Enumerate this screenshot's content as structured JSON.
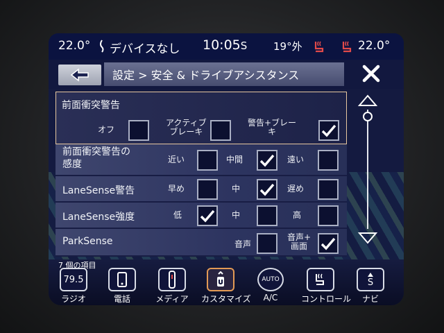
{
  "status": {
    "temp_left": "22.0°",
    "device": "デバイスなし",
    "time": "10:05",
    "time_suffix": "S",
    "outside_temp": "19°外",
    "temp_right": "22.0°"
  },
  "header": {
    "breadcrumb": "設定 > 安全 & ドライブアシスタンス"
  },
  "rows": [
    {
      "label": "前面衝突警告",
      "options": [
        {
          "label": "オフ",
          "checked": false
        },
        {
          "label": "アクティブ\nブレーキ",
          "checked": false
        },
        {
          "label": "警告+ブレー\nキ",
          "checked": true
        }
      ]
    },
    {
      "label": "前面衝突警告の\n感度",
      "options": [
        {
          "label": "近い",
          "checked": false
        },
        {
          "label": "中間",
          "checked": true
        },
        {
          "label": "遠い",
          "checked": false
        }
      ]
    },
    {
      "label": "LaneSense警告",
      "options": [
        {
          "label": "早め",
          "checked": false
        },
        {
          "label": "中",
          "checked": true
        },
        {
          "label": "遅め",
          "checked": false
        }
      ]
    },
    {
      "label": "LaneSense強度",
      "options": [
        {
          "label": "低",
          "checked": true
        },
        {
          "label": "中",
          "checked": false
        },
        {
          "label": "高",
          "checked": false
        }
      ]
    },
    {
      "label": "ParkSense",
      "options": [
        {
          "label": "音声",
          "checked": false
        },
        {
          "label": "音声+\n画面",
          "checked": true
        }
      ]
    }
  ],
  "dock": {
    "title": "7 個の項目",
    "items": [
      {
        "label": "ラジオ",
        "icon_text": "79.5",
        "icon": "radio-icon"
      },
      {
        "label": "電話",
        "icon_text": "",
        "icon": "phone-icon"
      },
      {
        "label": "メディア",
        "icon_text": "",
        "icon": "media-icon"
      },
      {
        "label": "カスタマイズ",
        "icon_text": "",
        "icon": "customize-icon",
        "active": true
      },
      {
        "label": "A/C",
        "icon_text": "AUTO",
        "icon": "ac-icon"
      },
      {
        "label": "コントロール",
        "icon_text": "",
        "icon": "controls-icon"
      },
      {
        "label": "ナビ",
        "icon_text": "S",
        "icon": "navigation-icon"
      }
    ]
  },
  "colors": {
    "accent_selected": "#e39a55",
    "row_bg": "#2d3460",
    "header_bg": "#0b1340"
  }
}
